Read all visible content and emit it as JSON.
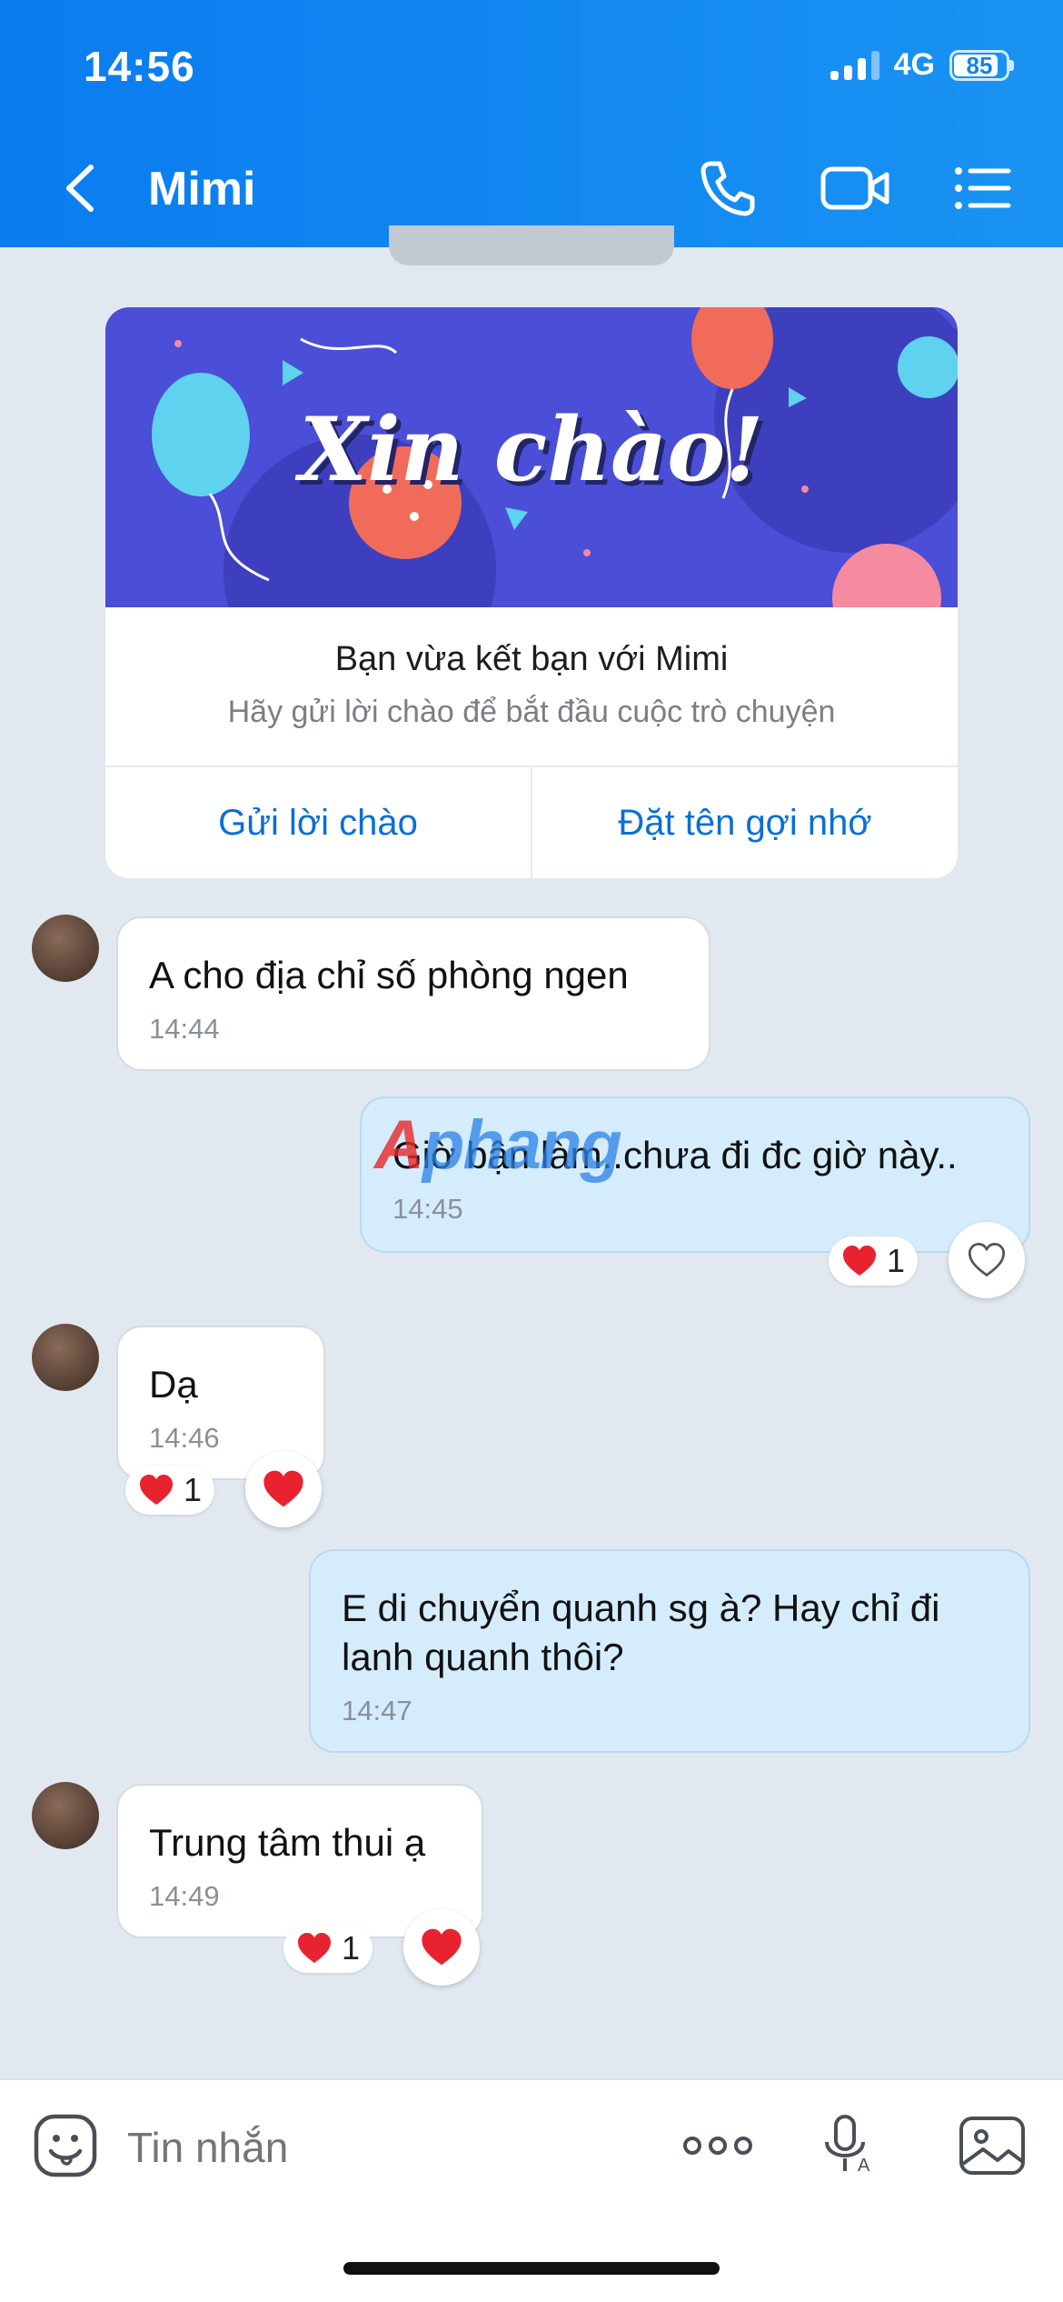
{
  "status_bar": {
    "time": "14:56",
    "network": "4G",
    "battery": "85"
  },
  "header": {
    "title": "Mimi"
  },
  "welcome_card": {
    "banner_text": "Xin chào!",
    "title": "Bạn vừa kết bạn với Mimi",
    "subtitle": "Hãy gửi lời chào để bắt đầu cuộc trò chuyện",
    "action_left": "Gửi lời chào",
    "action_right": "Đặt tên gợi nhớ"
  },
  "messages": [
    {
      "direction": "incoming",
      "text": "A cho địa chỉ số phòng ngen",
      "time": "14:44"
    },
    {
      "direction": "outgoing",
      "text": "Giờ bận làm..chưa đi đc giờ này..",
      "time": "14:45",
      "reactions": {
        "heart_count": "1"
      }
    },
    {
      "direction": "incoming",
      "text": "Dạ",
      "time": "14:46",
      "reactions": {
        "heart_count": "1"
      }
    },
    {
      "direction": "outgoing",
      "text": "E di chuyển quanh sg à? Hay chỉ đi lanh quanh thôi?",
      "time": "14:47"
    },
    {
      "direction": "incoming",
      "text": "Trung tâm thui ạ",
      "time": "14:49",
      "reactions": {
        "heart_count": "1"
      }
    }
  ],
  "watermark": {
    "part_a": "A",
    "part_b": "phang"
  },
  "composer": {
    "placeholder": "Tin nhắn"
  },
  "colors": {
    "header": "#0a7cf0",
    "accent": "#0a6fd6",
    "heart": "#e8232f",
    "outgoing_bubble": "#d5ecfc"
  },
  "icons": [
    "back-icon",
    "phone-icon",
    "video-call-icon",
    "menu-list-icon",
    "emoji-icon",
    "more-icon",
    "voice-icon",
    "image-icon",
    "heart-icon",
    "heart-outline-icon"
  ]
}
